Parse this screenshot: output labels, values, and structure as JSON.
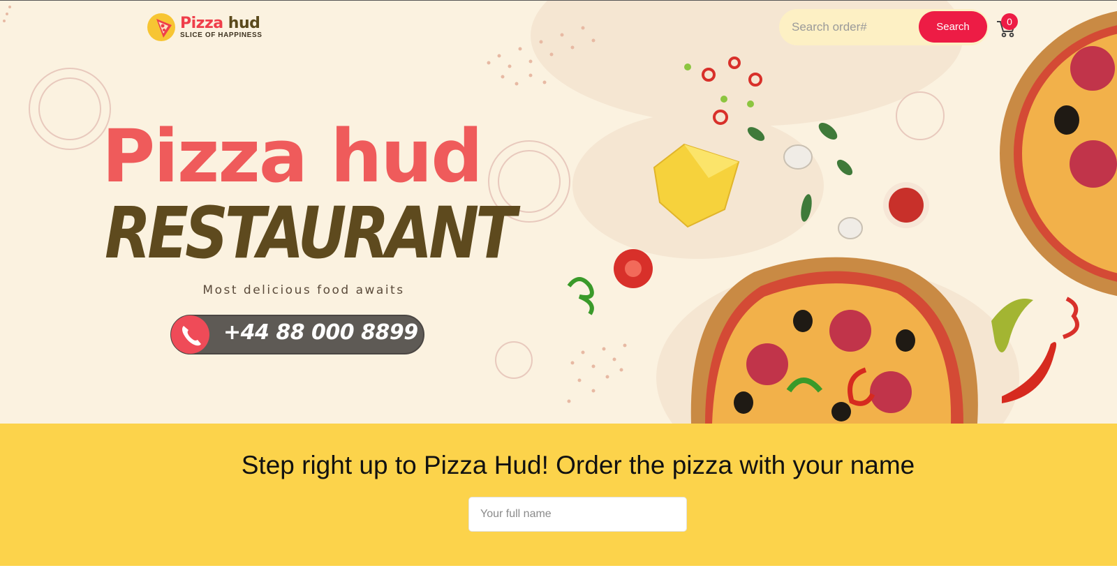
{
  "header": {
    "logo_name_primary": "Pizza",
    "logo_name_secondary": "hud",
    "logo_tagline": "SLICE OF HAPPINESS",
    "search": {
      "placeholder": "Search order#",
      "value": ""
    },
    "search_button_label": "Search",
    "cart_count": "0"
  },
  "hero": {
    "title": "Pizza hud",
    "subtitle": "RESTAURANT",
    "tagline": "Most delicious food awaits",
    "phone": "+44 88 000 8899"
  },
  "order": {
    "heading": "Step right up to Pizza Hud! Order the pizza with your name",
    "name_field": {
      "placeholder": "Your full name",
      "value": ""
    }
  },
  "colors": {
    "hero_background": "#fbf2e0",
    "brand_red": "#ed1c45",
    "title_red": "#ef5b5b",
    "title_brown": "#5e4a1e",
    "order_background": "#fcd34b"
  },
  "icons": [
    "pizza-slice-logo-icon",
    "cart-icon",
    "phone-icon"
  ]
}
